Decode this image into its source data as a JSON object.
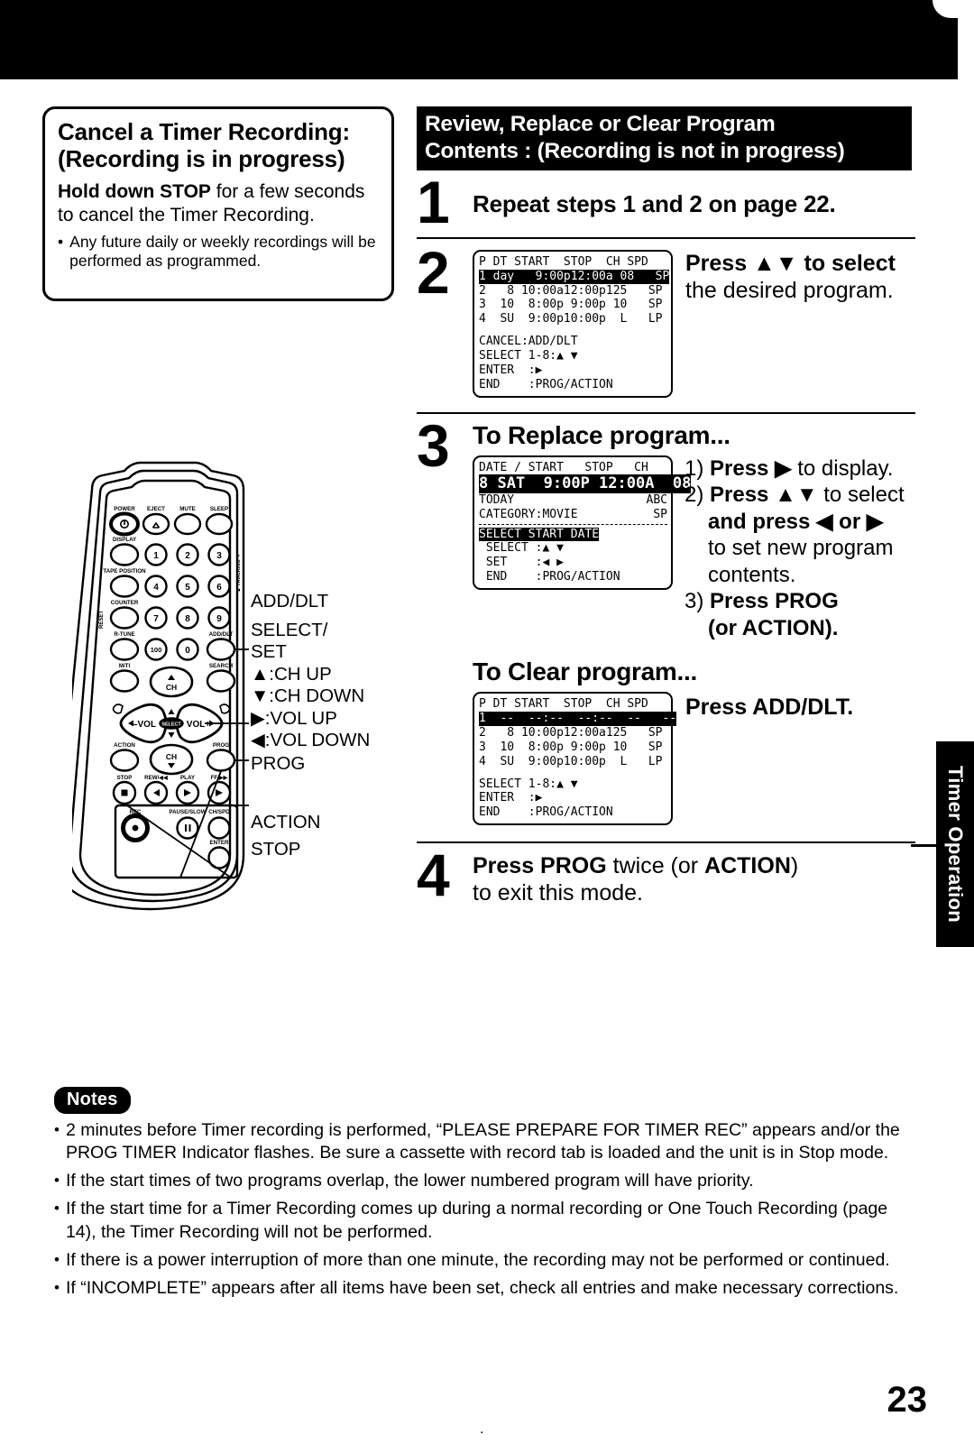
{
  "page": {
    "number": "23",
    "side_tab": "Timer Operation"
  },
  "cancel_box": {
    "title_line1": "Cancel a Timer Recording:",
    "title_line2": "(Recording is in progress)",
    "body_bold": "Hold down STOP",
    "body_rest": " for a few seconds to cancel the Timer Recording.",
    "bullet_dot": "•",
    "bullet": "Any future daily or weekly recordings will be performed as programmed."
  },
  "header": {
    "line1": "Review, Replace or Clear Program",
    "line2": "Contents : (Recording is not in progress)"
  },
  "steps": {
    "s1": {
      "num": "1",
      "text": "Repeat steps 1 and 2 on page 22."
    },
    "s2": {
      "num": "2",
      "text_bold": "Press ▲▼ to select",
      "text_rest": "the desired program."
    },
    "s3": {
      "num": "3",
      "heading": "To Replace program...",
      "item1": "1) ",
      "item1_bold": "Press ▶",
      "item1_rest": " to display.",
      "item2": "2) ",
      "item2_bold": "Press ▲▼",
      "item2_rest": " to select",
      "item2_line2_bold": "and press ◀ or ▶",
      "item2_line3": "to set new program",
      "item2_line4": "contents.",
      "item3": "3) ",
      "item3_bold": "Press PROG",
      "item3_line2": "(or ACTION)."
    },
    "clear": {
      "heading": "To Clear program...",
      "action": "Press ADD/DLT."
    },
    "s4": {
      "num": "4",
      "line1_a": "Press PROG",
      "line1_b": " twice (or ",
      "line1_c": "ACTION",
      "line1_d": ")",
      "line2": "to exit this mode."
    }
  },
  "osd_review": {
    "header": "P DT START  STOP  CH SPD",
    "rows": [
      {
        "text": "1 day   9:00p12:00a 08   SP",
        "highlight": true
      },
      {
        "text": "2   8 10:00a12:00p125   SP",
        "highlight": false
      },
      {
        "text": "3  10  8:00p 9:00p 10   SP",
        "highlight": false
      },
      {
        "text": "4  SU  9:00p10:00p  L   LP",
        "highlight": false
      }
    ],
    "menu": [
      "CANCEL:ADD/DLT",
      "SELECT 1-8:▲ ▼",
      "ENTER  :▶",
      "END    :PROG/ACTION"
    ]
  },
  "osd_replace": {
    "header": "DATE / START   STOP   CH",
    "highlight_row": "8 SAT  9:00P 12:00A  08",
    "line_today": "TODAY",
    "line_abc": "ABC",
    "line_category": "CATEGORY:MOVIE",
    "line_spd": "SP",
    "banner": "SELECT START DATE",
    "menu": [
      " SELECT :▲ ▼",
      " SET    :◀ ▶",
      " END    :PROG/ACTION"
    ]
  },
  "osd_clear": {
    "header": "P DT START  STOP  CH SPD",
    "rows": [
      {
        "text": "1  --  --:--  --:--  --   --",
        "highlight": true
      },
      {
        "text": "2   8 10:00p12:00a125   SP",
        "highlight": false
      },
      {
        "text": "3  10  8:00p 9:00p 10   SP",
        "highlight": false
      },
      {
        "text": "4  SU  9:00p10:00p  L   LP",
        "highlight": false
      }
    ],
    "menu": [
      "SELECT 1-8:▲ ▼",
      "ENTER  :▶",
      "END    :PROG/ACTION"
    ]
  },
  "remote": {
    "callout_adddlt": "ADD/DLT",
    "callout_select": "SELECT/",
    "callout_set": "SET",
    "callout_chup": "▲:CH UP",
    "callout_chdown": "▼:CH DOWN",
    "callout_volup": "▶:VOL UP",
    "callout_voldown": "◀:VOL DOWN",
    "callout_prog": "PROG",
    "callout_action": "ACTION",
    "callout_stop": "STOP",
    "buttons": {
      "power": "POWER",
      "eject": "EJECT",
      "mute": "MUTE",
      "sleep": "SLEEP",
      "display": "DISPLAY",
      "tape_position": "TAPE POSITION",
      "counter": "COUNTER",
      "r_tune": "R-TUNE",
      "multi": "M/TI",
      "adddlt": "ADD/DLT",
      "search": "SEARCH",
      "ch": "CH",
      "vol_minus": "–VOL",
      "vol_plus": "VOL+",
      "select": "SELECT",
      "action": "ACTION",
      "prog": "PROG",
      "stop": "STOP",
      "rew": "REW/◀◀",
      "play": "PLAY",
      "ff": "FF/▶▶",
      "rec": "REC",
      "pause_slow": "PAUSE/SLOW",
      "ch_spd": "CH/SPD",
      "enter": "ENTER",
      "reset": "RESET",
      "tracking": "TRACKING",
      "n1": "1",
      "n2": "2",
      "n3": "3",
      "n4": "4",
      "n5": "5",
      "n6": "6",
      "n7": "7",
      "n8": "8",
      "n9": "9",
      "n100": "100",
      "n0": "0"
    }
  },
  "notes": {
    "badge": "Notes",
    "dot": "•",
    "items": [
      "2 minutes before Timer recording is performed, “PLEASE PREPARE FOR TIMER REC” appears and/or the PROG TIMER Indicator flashes. Be sure a cassette with record tab is loaded and the unit is in Stop mode.",
      "If the start times of two programs overlap, the lower numbered program will have priority.",
      "If the start time for a Timer Recording comes up during a normal recording or One Touch Recording (page 14), the Timer Recording will not be performed.",
      "If there is a power interruption of more than one minute, the recording may not be performed or continued.",
      "If “INCOMPLETE” appears after all items have been set, check all entries and make necessary corrections."
    ]
  }
}
